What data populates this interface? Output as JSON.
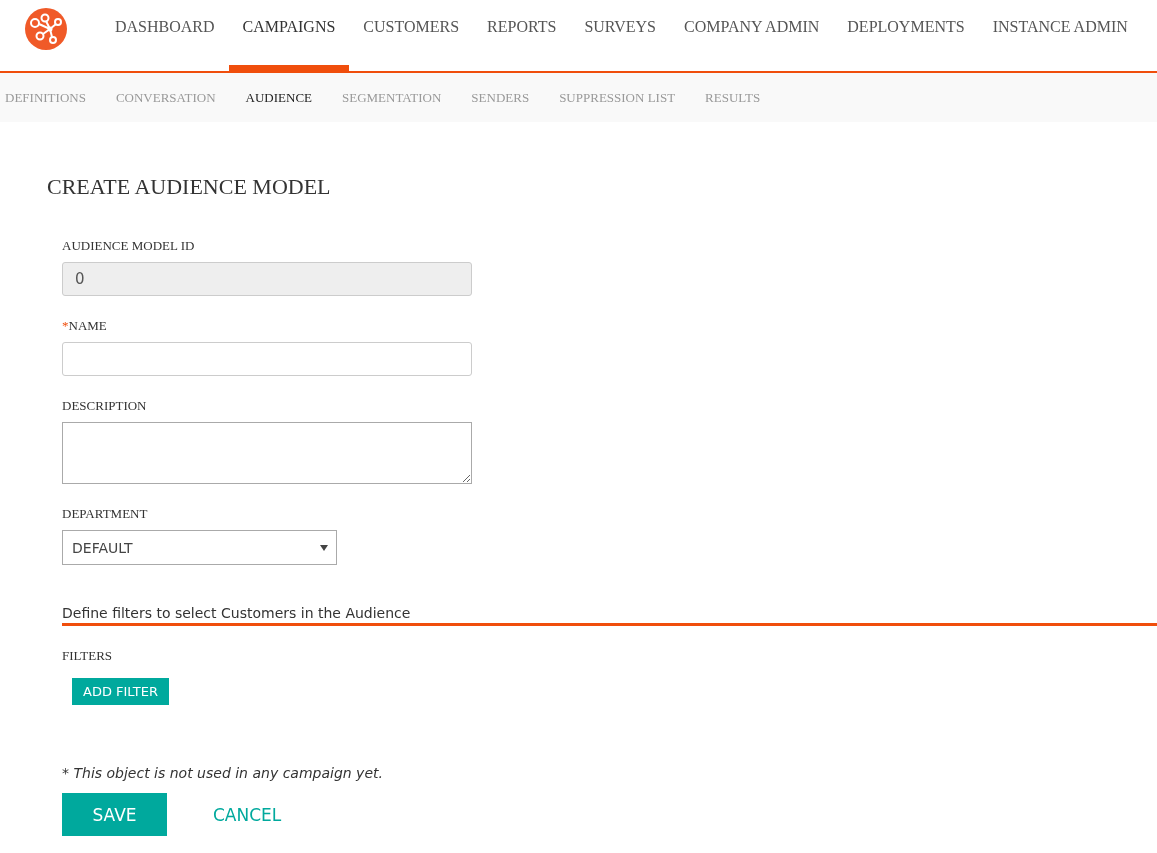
{
  "nav": {
    "items": [
      {
        "label": "DASHBOARD",
        "selected": false
      },
      {
        "label": "CAMPAIGNS",
        "selected": true
      },
      {
        "label": "CUSTOMERS",
        "selected": false
      },
      {
        "label": "REPORTS",
        "selected": false
      },
      {
        "label": "SURVEYS",
        "selected": false
      },
      {
        "label": "COMPANY ADMIN",
        "selected": false
      },
      {
        "label": "DEPLOYMENTS",
        "selected": false
      },
      {
        "label": "INSTANCE ADMIN",
        "selected": false
      }
    ]
  },
  "subnav": {
    "items": [
      {
        "label": "DEFINITIONS",
        "selected": false
      },
      {
        "label": "CONVERSATION",
        "selected": false
      },
      {
        "label": "AUDIENCE",
        "selected": true
      },
      {
        "label": "SEGMENTATION",
        "selected": false
      },
      {
        "label": "SENDERS",
        "selected": false
      },
      {
        "label": "SUPPRESSION LIST",
        "selected": false
      },
      {
        "label": "RESULTS",
        "selected": false
      }
    ]
  },
  "page_title": "CREATE AUDIENCE MODEL",
  "fields": [
    {
      "kind": "text",
      "label": "AUDIENCE MODEL ID",
      "value": "0",
      "disabled": true
    },
    {
      "kind": "text",
      "label": "NAME",
      "required_mark": "*",
      "disabled": false
    },
    {
      "kind": "textarea",
      "label": "DESCRIPTION",
      "disabled": false
    },
    {
      "kind": "select",
      "label": "DEPARTMENT",
      "value": "DEFAULT",
      "disabled": false
    }
  ],
  "filters_section": {
    "heading": "Define filters to select Customers in the Audience",
    "label": "FILTERS",
    "button": "ADD FILTER"
  },
  "note": "* This object is not used in any campaign yet.",
  "buttons": {
    "save": "SAVE",
    "cancel": "CANCEL"
  }
}
